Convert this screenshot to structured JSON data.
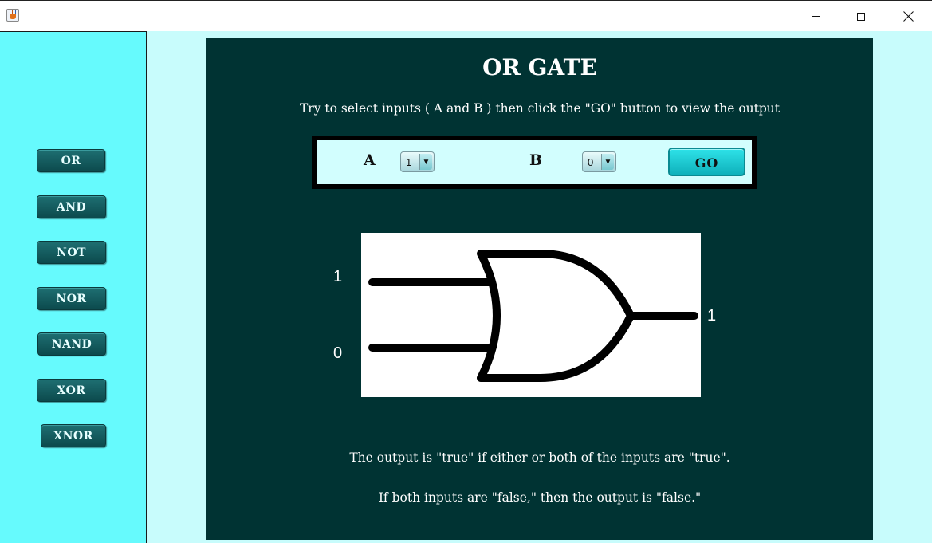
{
  "window": {
    "icons": {
      "app": "java-cup-icon",
      "minimize": "minimize-icon",
      "maximize": "maximize-icon",
      "close": "close-icon"
    }
  },
  "sidebar": {
    "items": [
      {
        "label": "OR"
      },
      {
        "label": "AND"
      },
      {
        "label": "NOT"
      },
      {
        "label": "NOR"
      },
      {
        "label": "NAND"
      },
      {
        "label": "XOR"
      },
      {
        "label": "XNOR"
      }
    ]
  },
  "main": {
    "title": "OR GATE",
    "instructions": "Try to select inputs ( A and B ) then click the \"GO\" button to view the output",
    "controls": {
      "a_label": "A",
      "a_value": "1",
      "b_label": "B",
      "b_value": "0",
      "go_label": "GO"
    },
    "diagram": {
      "input_a": "1",
      "input_b": "0",
      "output": "1"
    },
    "description_1": "The output is \"true\" if either or both of the inputs are \"true\".",
    "description_2": "If both inputs are \"false,\" then the output is \"false.\""
  },
  "colors": {
    "sidebar_bg": "#66fafd",
    "page_bg": "#c8fcfc",
    "main_bg": "#003333",
    "button_bg": "#0c4a4d",
    "go_button": "#1ec8d0"
  }
}
